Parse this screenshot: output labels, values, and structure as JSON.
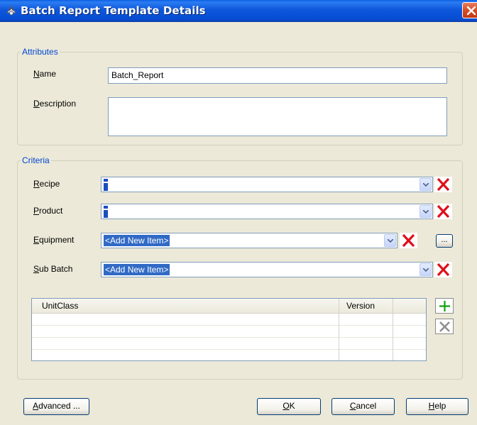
{
  "window": {
    "title": "Batch Report Template Details",
    "icon": "batch-report-icon"
  },
  "attributes": {
    "legend": "Attributes",
    "name_label_accel": "N",
    "name_label_rest": "ame",
    "name_value": "Batch_Report",
    "description_label_accel": "D",
    "description_label_rest": "escription",
    "description_value": ""
  },
  "criteria": {
    "legend": "Criteria",
    "recipe_accel": "R",
    "recipe_rest": "ecipe",
    "recipe_value": "",
    "product_accel": "P",
    "product_rest": "roduct",
    "product_value": "",
    "equipment_accel": "E",
    "equipment_rest": "quipment",
    "equipment_value": "<Add New Item>",
    "subbatch_accel": "S",
    "subbatch_rest": "ub Batch",
    "subbatch_value": "<Add New Item>",
    "ellipsis_label": "...",
    "grid": {
      "columns": [
        "UnitClass",
        "Version"
      ],
      "rows": []
    }
  },
  "buttons": {
    "advanced_accel": "A",
    "advanced_rest": "dvanced ...",
    "ok_accel": "O",
    "ok_rest": "K",
    "cancel_accel": "C",
    "cancel_rest": "ancel",
    "help_accel": "H",
    "help_rest": "elp"
  },
  "colors": {
    "accent_blue": "#0046D5",
    "delete_red": "#E0101A",
    "add_green": "#10A010",
    "selection": "#316AC5"
  }
}
